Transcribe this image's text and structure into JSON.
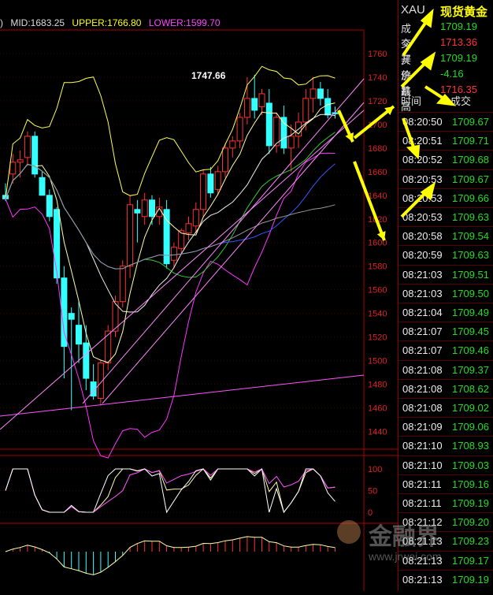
{
  "chart_data": {
    "type": "candlestick",
    "legend": {
      "lead": ")",
      "mid": "MID:1683.25",
      "upper": "UPPER:1766.80",
      "lower": "LOWER:1599.70"
    },
    "ylim": [
      1425,
      1780
    ],
    "y_ticks": [
      1760,
      1740,
      1720,
      1700,
      1680,
      1660,
      1640,
      1620,
      1600,
      1580,
      1560,
      1540,
      1520,
      1500,
      1480,
      1460,
      1440
    ],
    "annotation": "1747.66",
    "candles": [
      [
        1640,
        1650,
        1635,
        1637
      ],
      [
        1658,
        1675,
        1650,
        1668
      ],
      [
        1668,
        1678,
        1655,
        1670
      ],
      [
        1672,
        1694,
        1665,
        1690
      ],
      [
        1690,
        1694,
        1655,
        1658
      ],
      [
        1655,
        1660,
        1640,
        1640
      ],
      [
        1640,
        1645,
        1618,
        1622
      ],
      [
        1628,
        1630,
        1565,
        1570
      ],
      [
        1570,
        1580,
        1485,
        1512
      ],
      [
        1540,
        1545,
        1458,
        1535
      ],
      [
        1530,
        1550,
        1498,
        1514
      ],
      [
        1515,
        1530,
        1475,
        1485
      ],
      [
        1482,
        1497,
        1467,
        1470
      ],
      [
        1468,
        1500,
        1462,
        1498
      ],
      [
        1498,
        1530,
        1492,
        1525
      ],
      [
        1525,
        1555,
        1520,
        1550
      ],
      [
        1550,
        1585,
        1545,
        1580
      ],
      [
        1580,
        1640,
        1570,
        1632
      ],
      [
        1628,
        1636,
        1600,
        1625
      ],
      [
        1622,
        1642,
        1615,
        1636
      ],
      [
        1636,
        1640,
        1615,
        1622
      ],
      [
        1622,
        1638,
        1615,
        1630
      ],
      [
        1628,
        1636,
        1578,
        1582
      ],
      [
        1585,
        1600,
        1578,
        1596
      ],
      [
        1595,
        1612,
        1590,
        1610
      ],
      [
        1608,
        1622,
        1602,
        1616
      ],
      [
        1614,
        1634,
        1608,
        1628
      ],
      [
        1628,
        1662,
        1622,
        1658
      ],
      [
        1658,
        1664,
        1638,
        1642
      ],
      [
        1645,
        1665,
        1640,
        1660
      ],
      [
        1660,
        1684,
        1655,
        1680
      ],
      [
        1680,
        1690,
        1672,
        1686
      ],
      [
        1686,
        1710,
        1680,
        1706
      ],
      [
        1706,
        1740,
        1700,
        1722
      ],
      [
        1722,
        1742,
        1705,
        1712
      ],
      [
        1715,
        1730,
        1708,
        1726
      ],
      [
        1718,
        1730,
        1675,
        1682
      ],
      [
        1682,
        1710,
        1676,
        1706
      ],
      [
        1706,
        1716,
        1675,
        1680
      ],
      [
        1680,
        1700,
        1660,
        1690
      ],
      [
        1690,
        1710,
        1680,
        1702
      ],
      [
        1702,
        1730,
        1695,
        1722
      ],
      [
        1722,
        1740,
        1710,
        1730
      ],
      [
        1730,
        1736,
        1716,
        1722
      ],
      [
        1722,
        1730,
        1705,
        1708
      ],
      [
        1710,
        1715,
        1705,
        1709
      ]
    ],
    "oscillator_ticks": [
      100,
      50,
      0
    ]
  },
  "panel": {
    "symbol": "XAU",
    "name": "现货黄金",
    "quote": [
      {
        "label": "成交",
        "value": "1709.19",
        "color": "#22dd22"
      },
      {
        "label": "今开",
        "value": "1713.36",
        "color": "#ff3333"
      },
      {
        "label": "买价1",
        "value": "1709.19",
        "color": "#22dd22"
      },
      {
        "label": "涨跌",
        "value": "-4.16",
        "color": "#22dd22"
      },
      {
        "label": "最高",
        "value": "1716.35",
        "color": "#ff3333"
      }
    ],
    "col_time": "时间",
    "col_price": "成交",
    "ticks": [
      [
        "08:20:50",
        "1709.67"
      ],
      [
        "08:20:51",
        "1709.71"
      ],
      [
        "08:20:52",
        "1709.68"
      ],
      [
        "08:20:53",
        "1709.67"
      ],
      [
        "08:20:53",
        "1709.66"
      ],
      [
        "08:20:53",
        "1709.63"
      ],
      [
        "08:20:58",
        "1709.54"
      ],
      [
        "08:20:59",
        "1709.63"
      ],
      [
        "08:21:03",
        "1709.51"
      ],
      [
        "08:21:03",
        "1709.50"
      ],
      [
        "08:21:04",
        "1709.49"
      ],
      [
        "08:21:07",
        "1709.45"
      ],
      [
        "08:21:07",
        "1709.46"
      ],
      [
        "08:21:08",
        "1709.37"
      ],
      [
        "08:21:08",
        "1708.62"
      ],
      [
        "08:21:08",
        "1709.02"
      ],
      [
        "08:21:09",
        "1709.06"
      ],
      [
        "08:21:10",
        "1708.93"
      ],
      [
        "08:21:10",
        "1709.03"
      ],
      [
        "08:21:11",
        "1709.16"
      ],
      [
        "08:21:11",
        "1709.19"
      ],
      [
        "08:21:12",
        "1709.20"
      ],
      [
        "08:21:13",
        "1709.23"
      ],
      [
        "08:21:13",
        "1709.17"
      ],
      [
        "08:21:13",
        "1709.19"
      ]
    ]
  },
  "watermark": {
    "text": "金融界",
    "url": "www.jrwei.com"
  }
}
